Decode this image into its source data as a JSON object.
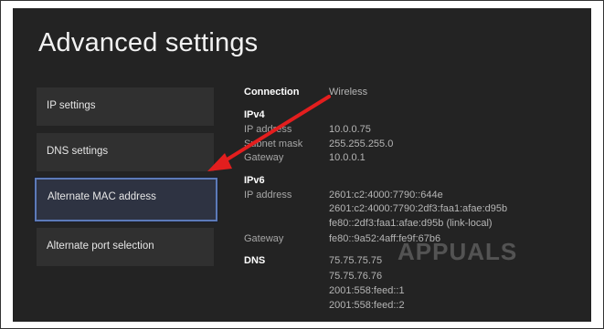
{
  "page": {
    "title": "Advanced settings"
  },
  "menu": [
    {
      "label": "IP settings"
    },
    {
      "label": "DNS settings"
    },
    {
      "label": "Alternate MAC address",
      "selected": true
    },
    {
      "label": "Alternate port selection"
    }
  ],
  "details": {
    "connection_label": "Connection",
    "connection_value": "Wireless",
    "ipv4": {
      "header": "IPv4",
      "ip_label": "IP address",
      "ip_value": "10.0.0.75",
      "mask_label": "Subnet mask",
      "mask_value": "255.255.255.0",
      "gateway_label": "Gateway",
      "gateway_value": "10.0.0.1"
    },
    "ipv6": {
      "header": "IPv6",
      "ip_label": "IP address",
      "ip_values": [
        "2601:c2:4000:7790::644e",
        "2601:c2:4000:7790:2df3:faa1:afae:d95b",
        "fe80::2df3:faa1:afae:d95b (link-local)"
      ],
      "gateway_label": "Gateway",
      "gateway_value": "fe80::9a52:4aff:fe9f:67b6"
    },
    "dns": {
      "header": "DNS",
      "values": [
        "75.75.75.75",
        "75.75.76.76",
        "2001:558:feed::1",
        "2001:558:feed::2"
      ]
    }
  },
  "annotation": {
    "arrow_color": "#e31e1e"
  },
  "watermark": {
    "text": "APPUALS"
  },
  "colors": {
    "background": "#232323",
    "selection_border": "#5d7ab8"
  }
}
